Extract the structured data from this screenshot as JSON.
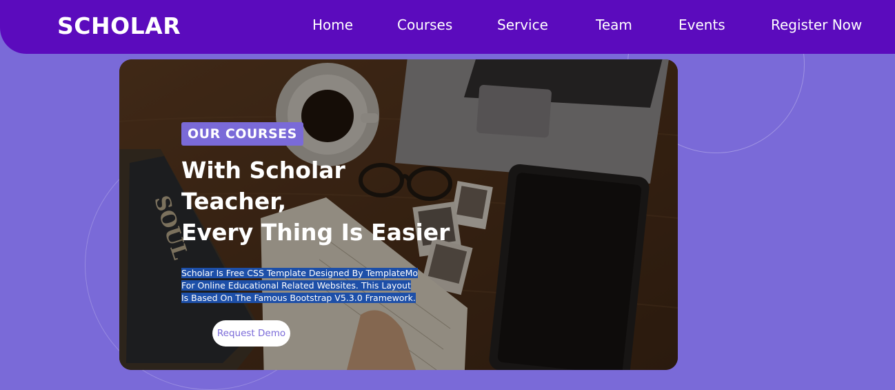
{
  "header": {
    "logo": "SCHOLAR",
    "nav": [
      {
        "label": "Home"
      },
      {
        "label": "Courses"
      },
      {
        "label": "Service"
      },
      {
        "label": "Team"
      },
      {
        "label": "Events"
      },
      {
        "label": "Register Now"
      }
    ]
  },
  "hero": {
    "badge": "OUR COURSES",
    "headline": [
      "With Scholar",
      "Teacher,",
      "Every Thing Is Easier"
    ],
    "description": "Scholar Is Free CSS Template Designed By TemplateMo For Online Educational Related Websites. This Layout Is Based On The Famous Bootstrap V5.3.0 Framework.",
    "cta_label": "Request Demo",
    "image_book_text": "SOUL"
  },
  "colors": {
    "page_background": "#7a6ad8",
    "header_background": "#5b0bbd",
    "accent": "#7a6ad8",
    "text_selection": "#1d4fa8"
  }
}
